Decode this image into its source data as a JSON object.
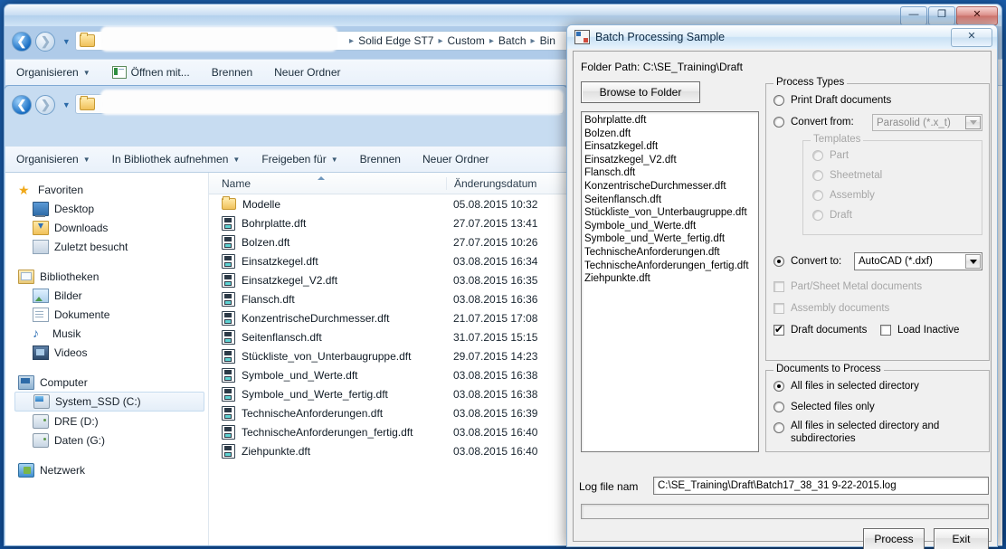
{
  "desktop": {
    "background_color": "#1758a5"
  },
  "window1": {
    "title": "",
    "controls": {
      "minimize": "—",
      "maximize": "❐",
      "close": "✕"
    },
    "breadcrumbs": [
      "Solid Edge ST7",
      "Custom",
      "Batch",
      "Bin"
    ],
    "path_redacted": true,
    "toolbar": [
      {
        "label": "Organisieren",
        "has_caret": true,
        "icon": ""
      },
      {
        "label": "Öffnen mit...",
        "has_caret": false,
        "icon": "open-with-icon"
      },
      {
        "label": "Brennen",
        "has_caret": false,
        "icon": ""
      },
      {
        "label": "Neuer Ordner",
        "has_caret": false,
        "icon": ""
      }
    ]
  },
  "window2": {
    "path_redacted": true,
    "toolbar": [
      {
        "label": "Organisieren",
        "has_caret": true
      },
      {
        "label": "In Bibliothek aufnehmen",
        "has_caret": true
      },
      {
        "label": "Freigeben für",
        "has_caret": true
      },
      {
        "label": "Brennen",
        "has_caret": false
      },
      {
        "label": "Neuer Ordner",
        "has_caret": false
      }
    ],
    "sidebar": [
      {
        "label": "Favoriten",
        "icon": "star-icon",
        "level": 0,
        "selected": false
      },
      {
        "label": "Desktop",
        "icon": "desktop-icon",
        "level": 1,
        "selected": false
      },
      {
        "label": "Downloads",
        "icon": "downloads-icon",
        "level": 1,
        "selected": false
      },
      {
        "label": "Zuletzt besucht",
        "icon": "recent-places-icon",
        "level": 1,
        "selected": false
      },
      {
        "label": "Bibliotheken",
        "icon": "libraries-icon",
        "level": 0,
        "selected": false,
        "gap_before": true
      },
      {
        "label": "Bilder",
        "icon": "pictures-icon",
        "level": 1,
        "selected": false
      },
      {
        "label": "Dokumente",
        "icon": "documents-icon",
        "level": 1,
        "selected": false
      },
      {
        "label": "Musik",
        "icon": "music-icon",
        "level": 1,
        "selected": false
      },
      {
        "label": "Videos",
        "icon": "videos-icon",
        "level": 1,
        "selected": false
      },
      {
        "label": "Computer",
        "icon": "computer-icon",
        "level": 0,
        "selected": false,
        "gap_before": true
      },
      {
        "label": "System_SSD (C:)",
        "icon": "system-drive-icon",
        "level": 1,
        "selected": true
      },
      {
        "label": "DRE (D:)",
        "icon": "drive-icon",
        "level": 1,
        "selected": false
      },
      {
        "label": "Daten (G:)",
        "icon": "drive-icon",
        "level": 1,
        "selected": false
      },
      {
        "label": "Netzwerk",
        "icon": "network-icon",
        "level": 0,
        "selected": false,
        "gap_before": true
      }
    ],
    "filelist": {
      "columns": [
        "Name",
        "Änderungsdatum"
      ],
      "sorted_column": "Name",
      "rows": [
        {
          "name": "Modelle",
          "icon": "folder-icon",
          "date": "05.08.2015 10:32"
        },
        {
          "name": "Bohrplatte.dft",
          "icon": "dft-file-icon",
          "date": "27.07.2015 13:41"
        },
        {
          "name": "Bolzen.dft",
          "icon": "dft-file-icon",
          "date": "27.07.2015 10:26"
        },
        {
          "name": "Einsatzkegel.dft",
          "icon": "dft-file-icon",
          "date": "03.08.2015 16:34"
        },
        {
          "name": "Einsatzkegel_V2.dft",
          "icon": "dft-file-icon",
          "date": "03.08.2015 16:35"
        },
        {
          "name": "Flansch.dft",
          "icon": "dft-file-icon",
          "date": "03.08.2015 16:36"
        },
        {
          "name": "KonzentrischeDurchmesser.dft",
          "icon": "dft-file-icon",
          "date": "21.07.2015 17:08"
        },
        {
          "name": "Seitenflansch.dft",
          "icon": "dft-file-icon",
          "date": "31.07.2015 15:15"
        },
        {
          "name": "Stückliste_von_Unterbaugruppe.dft",
          "icon": "dft-file-icon",
          "date": "29.07.2015 14:23"
        },
        {
          "name": "Symbole_und_Werte.dft",
          "icon": "dft-file-icon",
          "date": "03.08.2015 16:38"
        },
        {
          "name": "Symbole_und_Werte_fertig.dft",
          "icon": "dft-file-icon",
          "date": "03.08.2015 16:38"
        },
        {
          "name": "TechnischeAnforderungen.dft",
          "icon": "dft-file-icon",
          "date": "03.08.2015 16:39"
        },
        {
          "name": "TechnischeAnforderungen_fertig.dft",
          "icon": "dft-file-icon",
          "date": "03.08.2015 16:40"
        },
        {
          "name": "Ziehpunkte.dft",
          "icon": "dft-file-icon",
          "date": "03.08.2015 16:40"
        }
      ]
    }
  },
  "dialog": {
    "title": "Batch Processing Sample",
    "close_label": "✕",
    "folder_path_label": "Folder Path: C:\\SE_Training\\Draft",
    "browse_button": "Browse to Folder",
    "file_listbox": [
      "Bohrplatte.dft",
      "Bolzen.dft",
      "Einsatzkegel.dft",
      "Einsatzkegel_V2.dft",
      "Flansch.dft",
      "KonzentrischeDurchmesser.dft",
      "Seitenflansch.dft",
      "Stückliste_von_Unterbaugruppe.dft",
      "Symbole_und_Werte.dft",
      "Symbole_und_Werte_fertig.dft",
      "TechnischeAnforderungen.dft",
      "TechnischeAnforderungen_fertig.dft",
      "Ziehpunkte.dft"
    ],
    "process_types": {
      "group_title": "Process Types",
      "print_draft": {
        "label": "Print Draft documents",
        "checked": false,
        "enabled": true
      },
      "convert_from": {
        "label": "Convert from:",
        "checked": false,
        "enabled": true,
        "value": "Parasolid (*.x_t)",
        "combo_enabled": false
      },
      "templates": {
        "group_title": "Templates",
        "enabled": false,
        "options": [
          {
            "label": "Part",
            "checked": false
          },
          {
            "label": "Sheetmetal",
            "checked": false
          },
          {
            "label": "Assembly",
            "checked": false
          },
          {
            "label": "Draft",
            "checked": false
          }
        ]
      },
      "convert_to": {
        "label": "Convert to:",
        "checked": true,
        "enabled": true,
        "value": "AutoCAD (*.dxf)",
        "combo_enabled": true
      },
      "checkboxes": [
        {
          "label": "Part/Sheet Metal documents",
          "checked": false,
          "enabled": false
        },
        {
          "label": "Assembly documents",
          "checked": false,
          "enabled": false
        },
        {
          "label": "Draft documents",
          "checked": true,
          "enabled": true
        },
        {
          "label": "Load Inactive",
          "checked": false,
          "enabled": true
        }
      ]
    },
    "documents_to_process": {
      "group_title": "Documents to Process",
      "options": [
        {
          "label": "All files in selected directory",
          "checked": true
        },
        {
          "label": "Selected files only",
          "checked": false
        },
        {
          "label": "All files in selected directory and subdirectories",
          "checked": false
        }
      ]
    },
    "log": {
      "label": "Log file nam",
      "value": "C:\\SE_Training\\Draft\\Batch17_38_31 9-22-2015.log",
      "progress_percent": 0
    },
    "buttons": {
      "process": "Process",
      "exit": "Exit"
    }
  }
}
